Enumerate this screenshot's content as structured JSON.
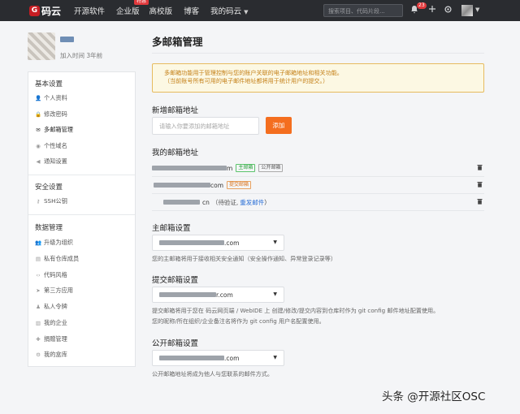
{
  "navbar": {
    "logo_mark": "G",
    "logo_text": "码云",
    "items": [
      {
        "label": "开源软件"
      },
      {
        "label": "企业版",
        "badge": "特惠"
      },
      {
        "label": "高校版"
      },
      {
        "label": "博客"
      },
      {
        "label": "我的码云"
      }
    ],
    "search_placeholder": "搜索项目、代码片段...",
    "notification_count": "23",
    "icons": [
      "bell-icon",
      "plus-icon",
      "gear-icon"
    ]
  },
  "profile": {
    "joined_text": "加入时间 3年前"
  },
  "sidebar": {
    "sections": [
      {
        "title": "基本设置",
        "items": [
          {
            "label": "个人资料",
            "icon": "user-icon"
          },
          {
            "label": "修改密码",
            "icon": "lock-icon"
          },
          {
            "label": "多邮箱管理",
            "icon": "envelope-icon",
            "active": true
          },
          {
            "label": "个性域名",
            "icon": "globe-icon"
          },
          {
            "label": "通知设置",
            "icon": "speaker-icon"
          }
        ]
      },
      {
        "title": "安全设置",
        "items": [
          {
            "label": "SSH公钥",
            "icon": "key-icon"
          }
        ]
      },
      {
        "title": "数据管理",
        "items": [
          {
            "label": "升级为组织",
            "icon": "group-icon"
          },
          {
            "label": "私有仓库成员",
            "icon": "book-icon"
          },
          {
            "label": "代码风格",
            "icon": "code-icon"
          },
          {
            "label": "第三方应用",
            "icon": "rocket-icon"
          },
          {
            "label": "私人令牌",
            "icon": "token-icon"
          },
          {
            "label": "我的企业",
            "icon": "enterprise-icon"
          },
          {
            "label": "捐赠管理",
            "icon": "donate-icon"
          },
          {
            "label": "我的盒库",
            "icon": "box-icon"
          }
        ]
      }
    ]
  },
  "main": {
    "title": "多邮箱管理",
    "notice_line1": "多邮箱功能用于管理控制与您的账户关联的电子邮箱地址和相关功能。",
    "notice_line2": "（当前账号所有可用的电子邮件地址都将用于统计用户的提交。）",
    "add_email": {
      "label": "新增邮箱地址",
      "placeholder": "请输入你要添加的邮箱地址",
      "button": "添加"
    },
    "my_emails": {
      "label": "我的邮箱地址",
      "rows": [
        {
          "suffix": "m",
          "tags": [
            {
              "text": "主邮箱",
              "style": "green"
            },
            {
              "text": "公开邮箱",
              "style": "gray"
            }
          ]
        },
        {
          "suffix": "com",
          "tags": [
            {
              "text": "提交邮箱",
              "style": "orange"
            }
          ]
        },
        {
          "suffix": "cn",
          "pending": "（待验证,",
          "resend": "重发邮件",
          "close": "）"
        }
      ]
    },
    "primary": {
      "label": "主邮箱设置",
      "selected": ".com",
      "help": "您的主邮箱将用于接收相关安全通知（安全操作通知、异常登录记录等）"
    },
    "commit": {
      "label": "提交邮箱设置",
      "selected": "r.com",
      "help_line1": "提交邮箱将用于您在 码云网页端 / WebIDE 上 创建/修改/提交内容到仓库时作为 git config 邮件地址配置使用。",
      "help_line2": "您的昵称/所在组织/企业备注名将作为 git config 用户名配置使用。"
    },
    "public": {
      "label": "公开邮箱设置",
      "selected": ".com",
      "help": "公开邮箱地址将成为他人与您联系的邮件方式。"
    }
  },
  "watermark": "头条 @开源社区OSC"
}
